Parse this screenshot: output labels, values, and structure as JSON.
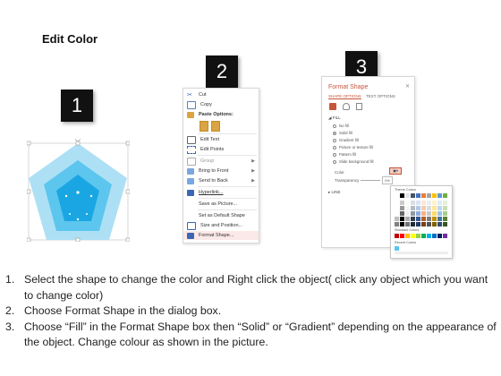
{
  "title": "Edit Color",
  "badges": [
    "1",
    "2",
    "3"
  ],
  "context_menu": {
    "items": [
      {
        "label": "Cut",
        "icon": "scissors-icon"
      },
      {
        "label": "Copy",
        "icon": "copy-icon"
      },
      {
        "label": "Paste Options:",
        "icon": "paste-icon"
      },
      {
        "label": "",
        "icon": "paste-option-icons"
      },
      {
        "label": "Edit Text",
        "icon": "edit-text-icon"
      },
      {
        "label": "Edit Points",
        "icon": "edit-points-icon"
      },
      {
        "label": "Group",
        "icon": "group-icon"
      },
      {
        "label": "Bring to Front",
        "icon": "bring-front-icon"
      },
      {
        "label": "Send to Back",
        "icon": "send-back-icon"
      },
      {
        "label": "Hyperlink...",
        "icon": "hyperlink-icon"
      },
      {
        "label": "Save as Picture...",
        "icon": ""
      },
      {
        "label": "Set as Default Shape",
        "icon": ""
      },
      {
        "label": "Size and Position...",
        "icon": "size-icon"
      },
      {
        "label": "Format Shape...",
        "icon": "format-shape-icon"
      }
    ]
  },
  "format_pane": {
    "title": "Format Shape",
    "tabs": [
      "SHAPE OPTIONS",
      "TEXT OPTIONS"
    ],
    "fill_header": "FILL",
    "fill_options": [
      "No fill",
      "Solid fill",
      "Gradient fill",
      "Picture or texture fill",
      "Pattern fill",
      "Slide background fill"
    ],
    "selected_fill": "Solid fill",
    "color_label": "Color",
    "transparency_label": "Transparency",
    "transparency_value": "0%",
    "line_header": "LINE",
    "palette": {
      "theme_label": "Theme Colors",
      "standard_label": "Standard Colors",
      "recent_label": "Recent Colors"
    }
  },
  "instructions": [
    {
      "num": "1.",
      "text": "Select the shape to change the color and Right click the object( click any object which you want to change color)"
    },
    {
      "num": "2.",
      "text": "Choose Format Shape in the dialog box."
    },
    {
      "num": "3.",
      "text": "Choose “Fill” in the Format Shape box then “Solid” or “Gradient” depending on the appearance of the object. Change colour as shown in the picture."
    }
  ],
  "colors": {
    "accent": "#c5553b",
    "pentagon_outer": "#aee0f5",
    "pentagon_mid": "#5cc6ee",
    "pentagon_inner": "#1aa6e2"
  }
}
